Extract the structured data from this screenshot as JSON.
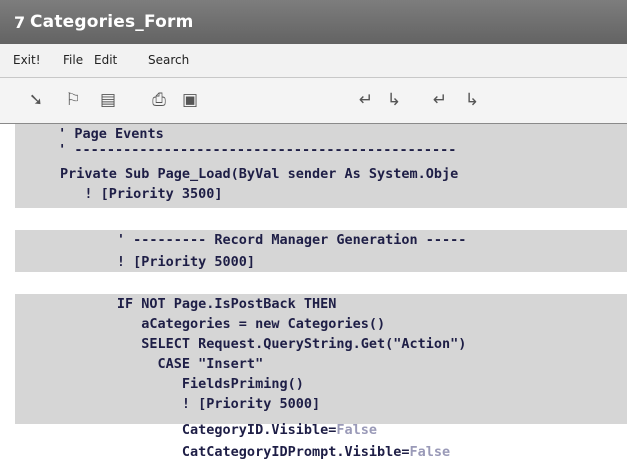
{
  "window": {
    "app_icon": "7",
    "title": "Categories_Form"
  },
  "menu": [
    "Exit!",
    "File",
    "Edit",
    "Search"
  ],
  "toolbar": {
    "icons": [
      "pointer-icon",
      "wand-icon",
      "database-icon",
      "print-icon",
      "form-icon",
      "indent-icon",
      "outdent-icon",
      "comment-icon",
      "uncomment-icon"
    ]
  },
  "code": {
    "lines": [
      " ' Page Events",
      " ' -----------------------------------------------",
      "Private Sub Page_Load(ByVal sender As System.Obje",
      "   ! [Priority 3500]",
      "",
      "       ' --------- Record Manager Generation -----",
      "       ! [Priority 5000]",
      "",
      "       IF NOT Page.IsPostBack THEN",
      "          aCategories = new Categories()",
      "          SELECT Request.QueryString.Get(\"Action\")",
      "            CASE \"Insert\"",
      "               FieldsPriming()",
      "               ! [Priority 5000]",
      "               CategoryID.Visible=",
      "               CatCategoryIDPrompt.Visible="
    ],
    "false_keyword": "False"
  }
}
